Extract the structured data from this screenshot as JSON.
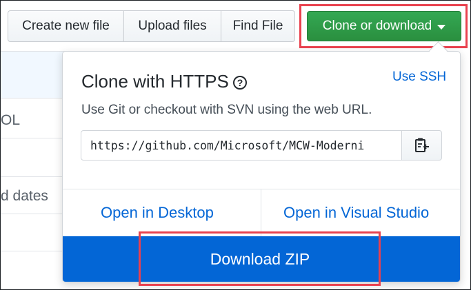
{
  "toolbar": {
    "create_new_file": "Create new file",
    "upload_files": "Upload files",
    "find_file": "Find File",
    "clone_or_download": "Clone or download"
  },
  "background_list": {
    "row_fragments": [
      "OL",
      "d dates"
    ]
  },
  "clone_panel": {
    "title": "Clone with HTTPS",
    "help_icon": "question-circle-icon",
    "use_ssh": "Use SSH",
    "description": "Use Git or checkout with SVN using the web URL.",
    "url_value": "https://github.com/Microsoft/MCW-Moderni",
    "copy_icon": "clipboard-icon",
    "open_in_desktop": "Open in Desktop",
    "open_in_visual_studio": "Open in Visual Studio",
    "download_zip": "Download ZIP"
  },
  "colors": {
    "clone_button": "#2ea44f",
    "link": "#0366d6",
    "download_bar": "#0366d6",
    "highlight": "#e9414e"
  }
}
